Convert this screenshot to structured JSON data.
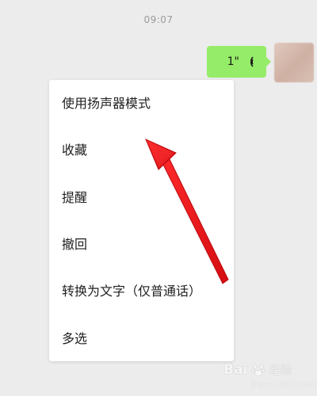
{
  "chat": {
    "timestamp": "09:07",
    "voice_message": {
      "duration": "1\"",
      "bubble_color": "#95ec69"
    },
    "avatar_icon": "blurred-avatar"
  },
  "context_menu": {
    "items": [
      {
        "label": "使用扬声器模式"
      },
      {
        "label": "收藏"
      },
      {
        "label": "提醒"
      },
      {
        "label": "撤回"
      },
      {
        "label": "转换为文字（仅普通话）"
      },
      {
        "label": "多选"
      }
    ]
  },
  "annotation": {
    "arrow_color": "#e8141a"
  },
  "watermark": {
    "logo": "Bai",
    "text": "经验",
    "sub": "jingyan.baidu.com"
  }
}
